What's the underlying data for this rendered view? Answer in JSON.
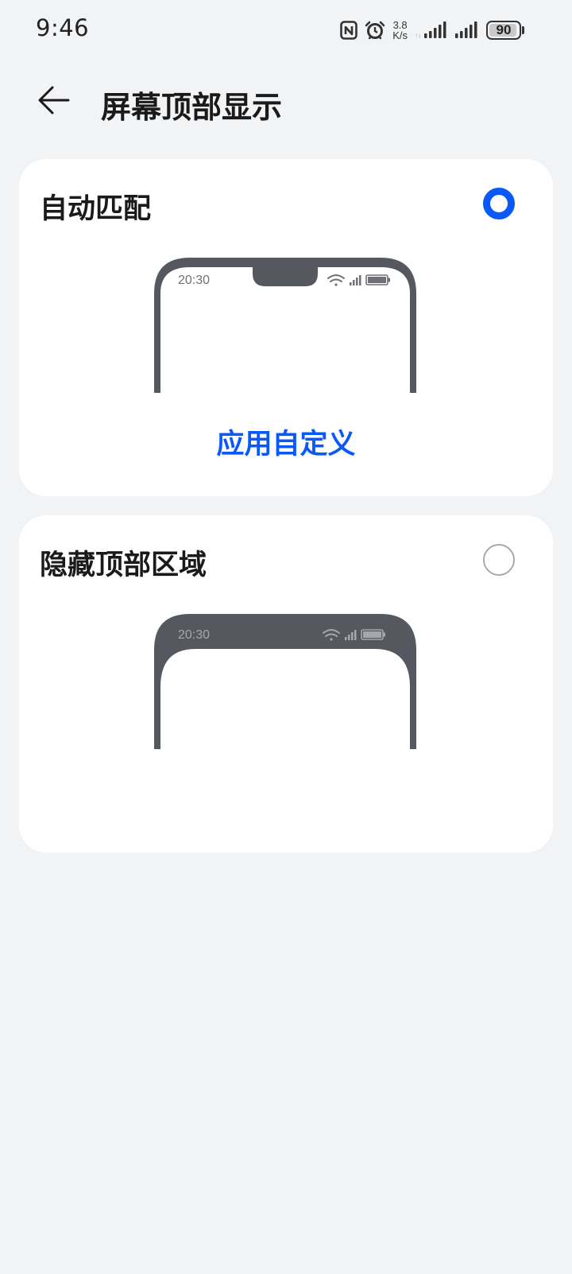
{
  "status_bar": {
    "time": "9:46",
    "net_speed_value": "3.8",
    "net_speed_unit": "K/s",
    "battery": "90",
    "battery_level": 0.9,
    "icons": [
      "nfc-icon",
      "alarm-icon",
      "signal-icon",
      "signal-icon",
      "battery-icon"
    ]
  },
  "header": {
    "title": "屏幕顶部显示",
    "back_icon": "arrow-left-icon"
  },
  "options": [
    {
      "label": "自动匹配",
      "selected": true,
      "illustration_time": "20:30",
      "link_label": "应用自定义"
    },
    {
      "label": "隐藏顶部区域",
      "selected": false,
      "illustration_time": "20:30"
    }
  ],
  "colors": {
    "accent": "#0a59f7",
    "background": "#f1f3f5",
    "card": "#ffffff",
    "phone_frame": "#55585e"
  }
}
